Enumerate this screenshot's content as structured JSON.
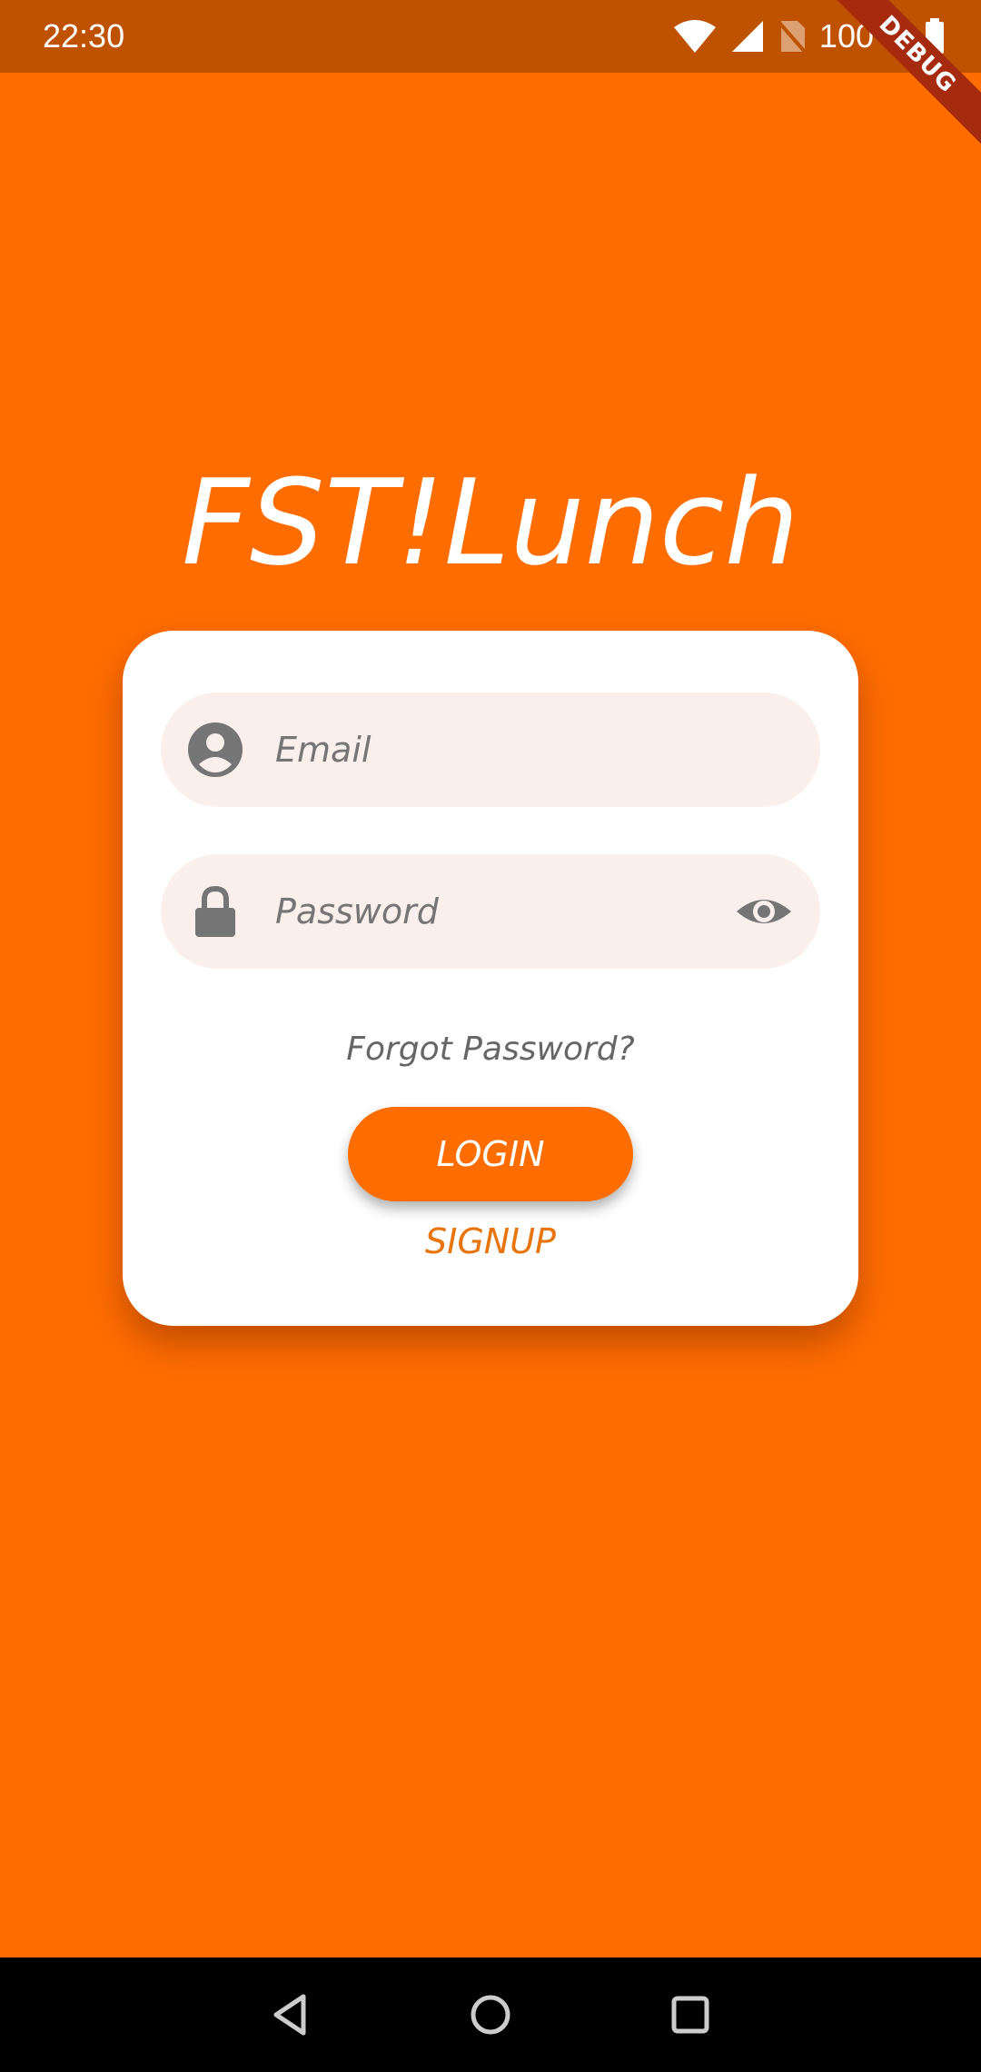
{
  "status_bar": {
    "time": "22:30",
    "battery": "100 %",
    "icons": [
      "wifi-icon",
      "signal-icon",
      "no-sim-icon",
      "battery-icon"
    ]
  },
  "debug_banner": "DEBUG",
  "app": {
    "title": "FST!Lunch"
  },
  "login_form": {
    "email_placeholder": "Email",
    "email_value": "",
    "password_placeholder": "Password",
    "password_value": "",
    "forgot_label": "Forgot Password?",
    "login_label": "LOGIN",
    "signup_label": "SIGNUP"
  },
  "nav_bar": {
    "buttons": [
      "back-icon",
      "home-icon",
      "recents-icon"
    ]
  },
  "colors": {
    "background": "#FF6D00",
    "status_bar": "#BF5200",
    "card": "#FFFFFF",
    "field": "#FAEFEA",
    "accent": "#FF6D00",
    "signup_text": "#E8740C",
    "icon_grey": "#757575"
  }
}
